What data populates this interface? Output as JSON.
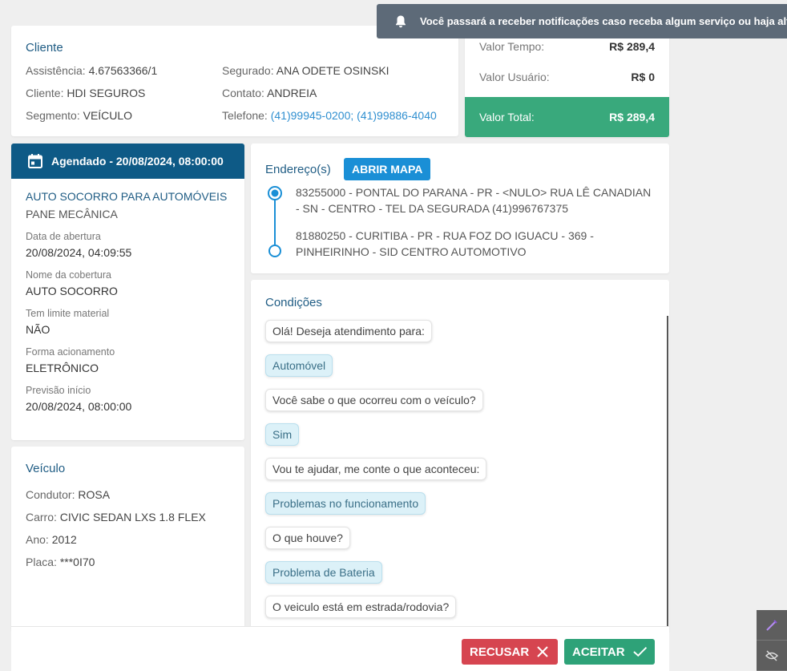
{
  "notification": {
    "text": "Você passará a receber notificações caso receba algum serviço ou haja alteração",
    "icon": "bell-icon"
  },
  "client": {
    "title": "Cliente",
    "left": [
      {
        "label": "Assistência:",
        "value": "4.67563366/1"
      },
      {
        "label": "Cliente:",
        "value": "HDI SEGUROS"
      },
      {
        "label": "Segmento:",
        "value": "VEÍCULO"
      }
    ],
    "right": [
      {
        "label": "Segurado:",
        "value": "ANA ODETE OSINSKI"
      },
      {
        "label": "Contato:",
        "value": "ANDREIA"
      },
      {
        "label": "Telefone:",
        "value": "(41)99945-0200; (41)99886-4040"
      }
    ]
  },
  "values": {
    "tempo_label": "Valor Tempo:",
    "tempo_value": "R$ 289,4",
    "usuario_label": "Valor Usuário:",
    "usuario_value": "R$ 0",
    "total_label": "Valor Total:",
    "total_value": "R$ 289,4",
    "total_color": "#39a97c"
  },
  "schedule": {
    "header": "Agendado - 20/08/2024, 08:00:00",
    "header_icon": "calendar-icon",
    "header_color": "#0e5a86",
    "service": "AUTO SOCORRO PARA AUTOMÓVEIS",
    "problem": "PANE MECÂNICA",
    "fields": [
      {
        "label": "Data de abertura",
        "value": "20/08/2024, 04:09:55"
      },
      {
        "label": "Nome da cobertura",
        "value": "AUTO SOCORRO"
      },
      {
        "label": "Tem limite material",
        "value": "NÃO"
      },
      {
        "label": "Forma acionamento",
        "value": "ELETRÔNICO"
      },
      {
        "label": "Previsão início",
        "value": "20/08/2024, 08:00:00"
      }
    ]
  },
  "vehicle": {
    "title": "Veículo",
    "items": [
      {
        "label": "Condutor:",
        "value": "ROSA"
      },
      {
        "label": "Carro:",
        "value": "CIVIC SEDAN LXS 1.8 FLEX"
      },
      {
        "label": "Ano:",
        "value": "2012"
      },
      {
        "label": "Placa:",
        "value": "***0I70"
      }
    ]
  },
  "address": {
    "title": "Endereço(s)",
    "map_button": "ABRIR MAPA",
    "origin": "83255000 - PONTAL DO PARANA - PR - <NULO> RUA LÊ CANADIAN - SN - CENTRO - TEL DA SEGURADA (41)996767375",
    "destination": "81880250 - CURITIBA - PR - RUA FOZ DO IGUACU - 369 - PINHEIRINHO - SID CENTRO AUTOMOTIVO"
  },
  "conditions": {
    "title": "Condições",
    "messages": [
      {
        "type": "q",
        "text": "Olá! Deseja atendimento para:"
      },
      {
        "type": "a",
        "text": "Automóvel"
      },
      {
        "type": "q",
        "text": "Você sabe o que ocorreu com o veículo?"
      },
      {
        "type": "a",
        "text": "Sim"
      },
      {
        "type": "q",
        "text": "Vou te ajudar, me conte o que aconteceu:"
      },
      {
        "type": "a",
        "text": "Problemas no funcionamento"
      },
      {
        "type": "q",
        "text": "O que houve?"
      },
      {
        "type": "a",
        "text": "Problema de Bateria"
      },
      {
        "type": "q",
        "text": "O veiculo está em estrada/rodovia?"
      }
    ]
  },
  "actions": {
    "reject": "RECUSAR",
    "reject_color": "#d64550",
    "accept": "ACEITAR",
    "accept_color": "#2ea278"
  }
}
